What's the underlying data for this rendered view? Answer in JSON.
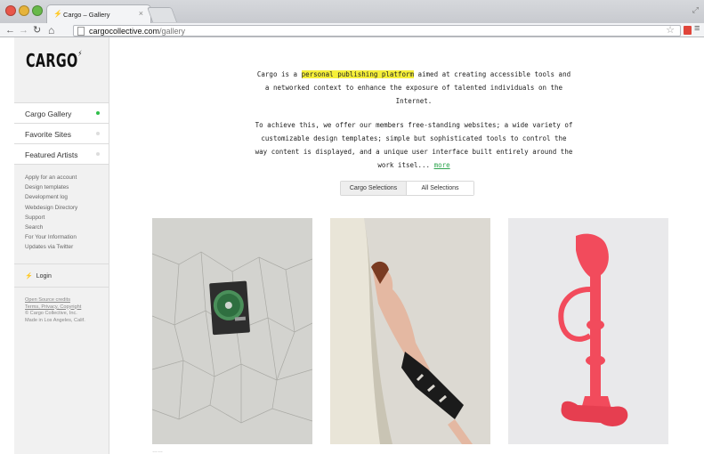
{
  "browser": {
    "tab_title": "Cargo – Gallery",
    "tab_close": "×",
    "url_host": "cargocollective.com",
    "url_path": "/gallery"
  },
  "sidebar": {
    "logo": "CARGO",
    "logo_mark": "⚡",
    "nav": [
      {
        "label": "Cargo Gallery",
        "active": true
      },
      {
        "label": "Favorite Sites",
        "active": false
      },
      {
        "label": "Featured Artists",
        "active": false
      }
    ],
    "links": [
      "Apply for an account",
      "Design templates",
      "Development log",
      "Webdesign Directory",
      "Support",
      "Search",
      "For Your Information",
      "Updates via Twitter"
    ],
    "login_label": "Login",
    "footer": [
      "Open Source credits",
      "Terms, Privacy, Copyright",
      "© Cargo Collective, Inc.",
      "Made in Los Angeles, Calif."
    ]
  },
  "intro": {
    "p1_before": "Cargo is a ",
    "p1_highlight": "personal publishing platform",
    "p1_after": " aimed at creating accessible tools and a networked context to enhance the exposure of talented individuals on the Internet.",
    "p2": "To achieve this, we offer our members free-standing websites; a wide variety of customizable design templates; simple but sophisticated tools to control the way content is displayed, and a unique user interface built entirely around the work itsel... ",
    "more_label": "more"
  },
  "selections": {
    "tabs": [
      "Cargo Selections",
      "All Selections"
    ],
    "active_index": 0
  },
  "gallery": {
    "caption": "……"
  },
  "colors": {
    "accent_green": "#2fbe4a",
    "highlight_yellow": "#f6f03a",
    "sculpture_red": "#f24b5c"
  }
}
